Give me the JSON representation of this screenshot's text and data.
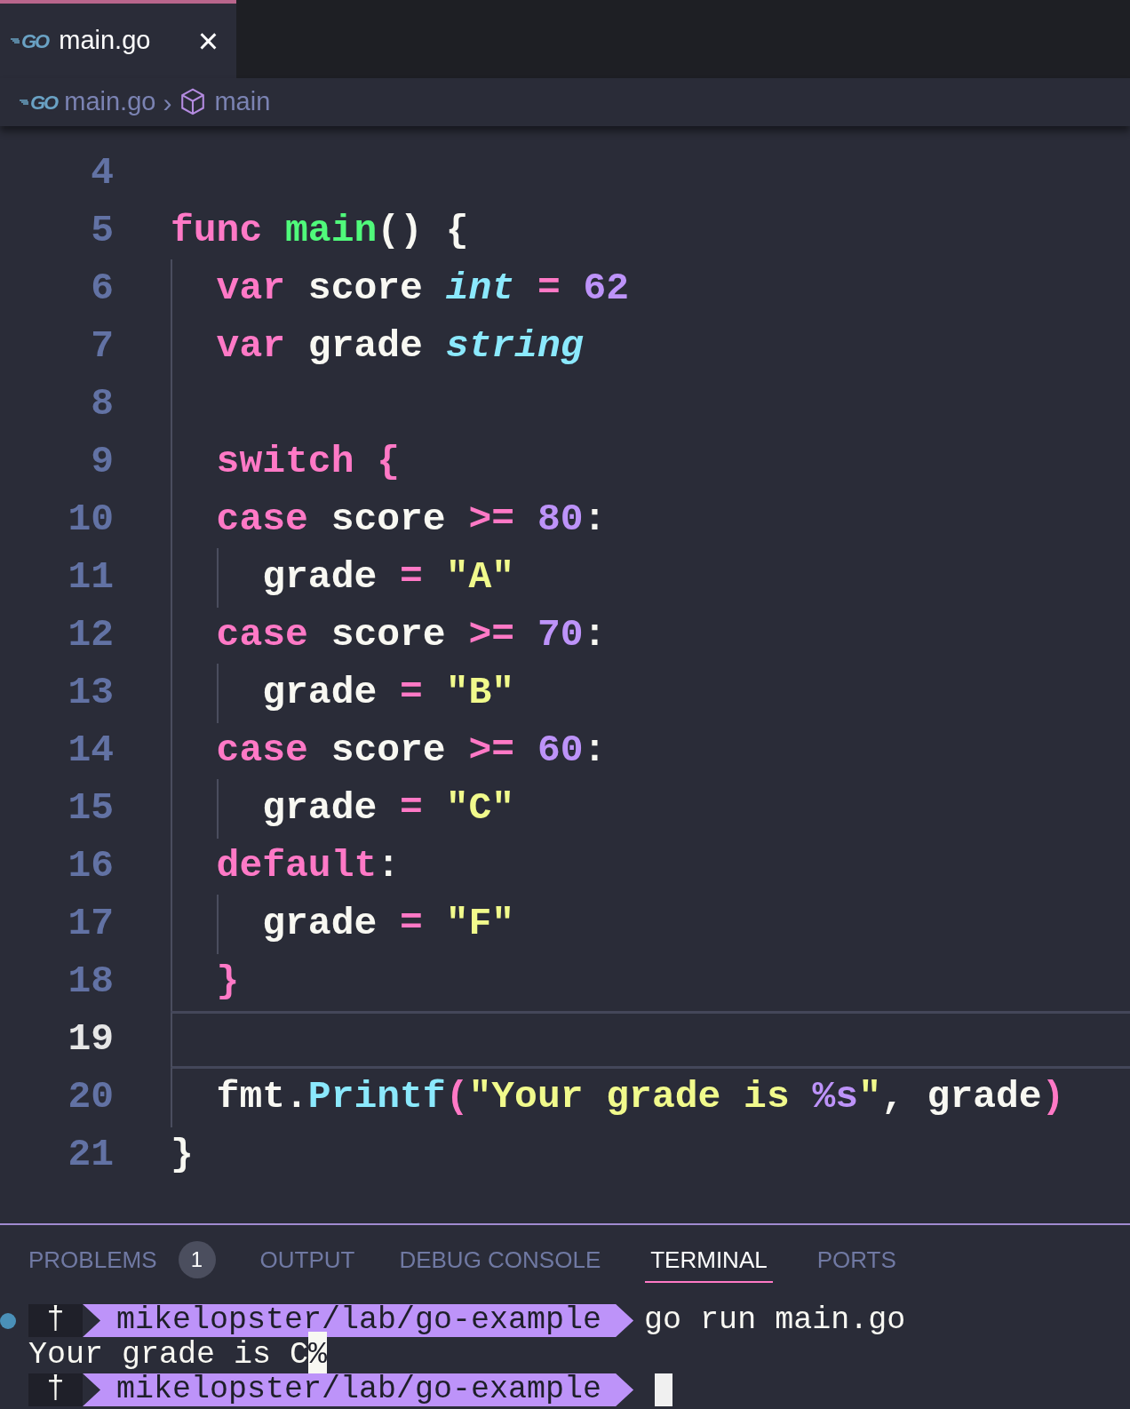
{
  "editor_tabs": [
    {
      "logo": "GO",
      "label": "main.go",
      "selected": true,
      "close": "×"
    }
  ],
  "breadcrumb": {
    "file_logo": "GO",
    "file": "main.go",
    "separator": "›",
    "symbol": "main"
  },
  "code_lines": [
    {
      "number": "4",
      "current": false
    },
    {
      "number": "5",
      "current": false,
      "tokens": [
        {
          "kind": "keyword",
          "text": "func"
        },
        {
          "kind": "func",
          "text": " main"
        },
        {
          "kind": "plain",
          "text": "() {"
        }
      ]
    },
    {
      "number": "6",
      "current": false,
      "tokens": [
        {
          "kind": "keyword",
          "text": "  var"
        },
        {
          "kind": "plain",
          "text": " score "
        },
        {
          "kind": "type",
          "text": "int"
        },
        {
          "kind": "op",
          "text": " ="
        },
        {
          "kind": "number",
          "text": " 62"
        }
      ]
    },
    {
      "number": "7",
      "current": false,
      "tokens": [
        {
          "kind": "keyword",
          "text": "  var"
        },
        {
          "kind": "plain",
          "text": " grade "
        },
        {
          "kind": "type",
          "text": "string"
        }
      ]
    },
    {
      "number": "8",
      "current": false
    },
    {
      "number": "9",
      "current": false,
      "tokens": [
        {
          "kind": "keyword",
          "text": "  switch {"
        }
      ]
    },
    {
      "number": "10",
      "current": false,
      "tokens": [
        {
          "kind": "keyword",
          "text": "  case"
        },
        {
          "kind": "plain",
          "text": " score "
        },
        {
          "kind": "op",
          "text": ">="
        },
        {
          "kind": "number",
          "text": " 80"
        },
        {
          "kind": "plain",
          "text": ":"
        }
      ]
    },
    {
      "number": "11",
      "current": false,
      "tokens": [
        {
          "kind": "plain",
          "text": "    grade "
        },
        {
          "kind": "op",
          "text": "="
        },
        {
          "kind": "string",
          "text": " \"A\""
        }
      ]
    },
    {
      "number": "12",
      "current": false,
      "tokens": [
        {
          "kind": "keyword",
          "text": "  case"
        },
        {
          "kind": "plain",
          "text": " score "
        },
        {
          "kind": "op",
          "text": ">="
        },
        {
          "kind": "number",
          "text": " 70"
        },
        {
          "kind": "plain",
          "text": ":"
        }
      ]
    },
    {
      "number": "13",
      "current": false,
      "tokens": [
        {
          "kind": "plain",
          "text": "    grade "
        },
        {
          "kind": "op",
          "text": "="
        },
        {
          "kind": "string",
          "text": " \"B\""
        }
      ]
    },
    {
      "number": "14",
      "current": false,
      "tokens": [
        {
          "kind": "keyword",
          "text": "  case"
        },
        {
          "kind": "plain",
          "text": " score "
        },
        {
          "kind": "op",
          "text": ">="
        },
        {
          "kind": "number",
          "text": " 60"
        },
        {
          "kind": "plain",
          "text": ":"
        }
      ]
    },
    {
      "number": "15",
      "current": false,
      "tokens": [
        {
          "kind": "plain",
          "text": "    grade "
        },
        {
          "kind": "op",
          "text": "="
        },
        {
          "kind": "string",
          "text": " \"C\""
        }
      ]
    },
    {
      "number": "16",
      "current": false,
      "tokens": [
        {
          "kind": "keyword",
          "text": "  default"
        },
        {
          "kind": "plain",
          "text": ":"
        }
      ]
    },
    {
      "number": "17",
      "current": false,
      "tokens": [
        {
          "kind": "plain",
          "text": "    grade "
        },
        {
          "kind": "op",
          "text": "="
        },
        {
          "kind": "string",
          "text": " \"F\""
        }
      ]
    },
    {
      "number": "18",
      "current": false,
      "tokens": [
        {
          "kind": "keyword",
          "text": "  }"
        }
      ]
    },
    {
      "number": "19",
      "current": true
    },
    {
      "number": "20",
      "current": false,
      "tokens": [
        {
          "kind": "plain",
          "text": "  fmt."
        },
        {
          "kind": "method",
          "text": "Printf"
        },
        {
          "kind": "bracket",
          "text": "("
        },
        {
          "kind": "string",
          "text": "\"Your grade is "
        },
        {
          "kind": "format",
          "text": "%s"
        },
        {
          "kind": "string",
          "text": "\""
        },
        {
          "kind": "plain",
          "text": ", grade"
        },
        {
          "kind": "bracket",
          "text": ")"
        }
      ]
    },
    {
      "number": "21",
      "current": false,
      "tokens": [
        {
          "kind": "plain",
          "text": "}"
        }
      ]
    }
  ],
  "panel_tabs": [
    {
      "label": "PROBLEMS",
      "selected": false,
      "badge": "1"
    },
    {
      "label": "OUTPUT",
      "selected": false
    },
    {
      "label": "DEBUG CONSOLE",
      "selected": false
    },
    {
      "label": "TERMINAL",
      "selected": true
    },
    {
      "label": "PORTS",
      "selected": false
    }
  ],
  "terminal_lines": [
    {
      "kind": "prompt",
      "marker": true,
      "symbol": "†",
      "path": "mikelopster/lab/go-example",
      "command": "go run main.go",
      "cursor": false
    },
    {
      "kind": "output",
      "text": "Your grade is C",
      "end_mark": "%"
    },
    {
      "kind": "prompt",
      "marker": false,
      "symbol": "†",
      "path": "mikelopster/lab/go-example",
      "cursor": true
    }
  ]
}
